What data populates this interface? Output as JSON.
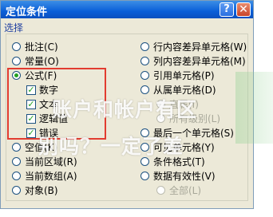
{
  "dialog": {
    "title": "定位条件",
    "help_glyph": "?",
    "close_glyph": "✕"
  },
  "group_label": "选择",
  "left_options": [
    {
      "label": "批注(C)"
    },
    {
      "label": "常量(O)"
    },
    {
      "label": "公式(F)"
    },
    {
      "label": "空值(K)"
    },
    {
      "label": "当前区域(R)"
    },
    {
      "label": "当前数组(A)"
    },
    {
      "label": "对象(B)"
    }
  ],
  "formula_sub": [
    {
      "label": "数字"
    },
    {
      "label": "文本"
    },
    {
      "label": "逻辑值"
    },
    {
      "label": "错误"
    }
  ],
  "right_options": [
    {
      "label": "行内容差异单元格(W)"
    },
    {
      "label": "列内容差异单元格(M)"
    },
    {
      "label": "引用单元格(P)"
    },
    {
      "label": "从属单元格(D)"
    },
    {
      "label": "直属(I)"
    },
    {
      "label": "所有级别(L)"
    },
    {
      "label": "最后一个单元格(S)"
    },
    {
      "label": "可见单元格(Y)"
    },
    {
      "label": "条件格式(T)"
    },
    {
      "label": "数据有效性(V)"
    },
    {
      "label": "全部(L)"
    }
  ],
  "overlay": {
    "line1": "账户和帐户有区",
    "line2": "别吗？一定了差"
  },
  "colors": {
    "title_bar": "#0a5fd8",
    "highlight_box": "#e23c30",
    "check_mark": "#21a121"
  }
}
